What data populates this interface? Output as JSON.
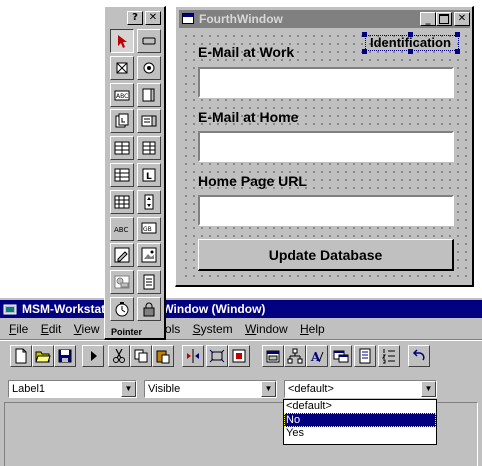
{
  "fourth_window": {
    "title": "FourthWindow",
    "identification_label": "Identification",
    "email_work_label": "E-Mail at Work",
    "email_home_label": "E-Mail at Home",
    "homepage_label": "Home Page URL",
    "update_button": "Update Database"
  },
  "palette": {
    "title_buttons": {
      "help": "?",
      "close": "✕"
    },
    "footer_label": "Pointer",
    "tools": [
      "pointer-icon",
      "rectangle-icon",
      "checkbox-icon",
      "radio-button-icon",
      "text-box-icon",
      "frame-icon",
      "tab-order-icon",
      "scroll-text-icon",
      "table-icon",
      "table-2-icon",
      "list-icon",
      "label-list-icon",
      "grid-icon",
      "spinner-icon",
      "text-label-icon",
      "picture-icon",
      "pencil-icon",
      "image-icon",
      "ole-object-icon",
      "notepad-icon",
      "timer-icon",
      "lock-icon"
    ]
  },
  "app_window": {
    "title": "MSM-Workstat…FourthWindow (Window)",
    "title_left": "MSM-Workstat",
    "title_right": "hWindow (Window)",
    "menu": [
      "File",
      "Edit",
      "View",
      "Tools",
      "System",
      "Window",
      "Help"
    ],
    "menu_visible": {
      "file": "File",
      "edit": "Edit",
      "view": "View",
      "tools": "ols",
      "system": "System",
      "window": "Window",
      "help": "Help"
    }
  },
  "property_bar": {
    "object_select": "Label1",
    "property_select": "Visible",
    "value_select": "<default>",
    "dropdown_options": [
      "<default>",
      "No",
      "Yes"
    ],
    "dropdown_selected": "No"
  },
  "colors": {
    "title_active": "#000080",
    "title_inactive": "#808080",
    "face": "#c0c0c0",
    "selection": "#000080"
  }
}
